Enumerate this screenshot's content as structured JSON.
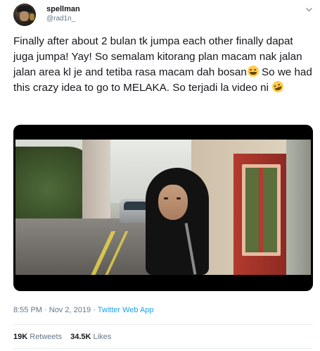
{
  "author": {
    "name": "spellman",
    "handle": "@rad1n_"
  },
  "tweet": {
    "text_part1": "Finally after about 2 bulan tk jumpa each other finally dapat juga jumpa!  Yay! So semalam kitorang plan macam nak jalan jalan area kl je and tetiba rasa macam dah bosan",
    "emoji1": "face-with-tears-of-joy",
    "text_part2": " So we had this crazy idea to go to MELAKA. So terjadi la video ni ",
    "emoji2": "rolling-on-the-floor-laughing"
  },
  "meta": {
    "time": "8:55 PM",
    "separator1": " · ",
    "date": "Nov 2, 2019",
    "separator2": " · ",
    "app": "Twitter Web App"
  },
  "stats": {
    "retweets_count": "19K",
    "retweets_label": "Retweets",
    "likes_count": "34.5K",
    "likes_label": "Likes"
  },
  "colors": {
    "link": "#1da1f2",
    "secondary_text": "#657786",
    "primary_text": "#14171a",
    "divider": "#e6ecf0"
  }
}
